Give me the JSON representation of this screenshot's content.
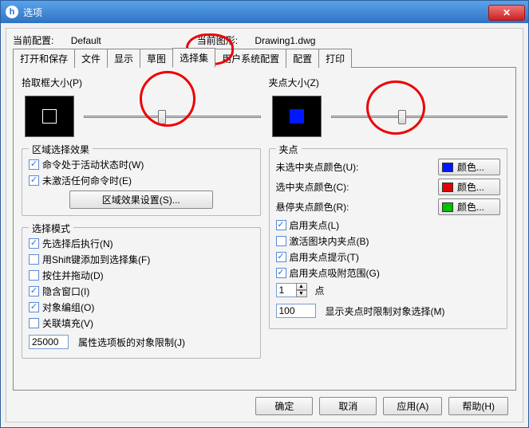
{
  "window": {
    "title": "选项",
    "app_glyph": "h"
  },
  "info": {
    "config_label": "当前配置:",
    "config_value": "Default",
    "drawing_label": "当前图形:",
    "drawing_value": "Drawing1.dwg"
  },
  "tabs": [
    "打开和保存",
    "文件",
    "显示",
    "草图",
    "选择集",
    "用户系统配置",
    "配置",
    "打印"
  ],
  "active_tab": "选择集",
  "left": {
    "pickbox_label": "拾取框大小(P)",
    "area_effect": {
      "title": "区域选择效果",
      "active_cmd": "命令处于活动状态时(W)",
      "inactive_cmd": "未激活任何命令时(E)",
      "settings_btn": "区域效果设置(S)..."
    },
    "select_mode": {
      "title": "选择模式",
      "pre_select": "先选择后执行(N)",
      "shift_add": "用Shift键添加到选择集(F)",
      "press_drag": "按住并拖动(D)",
      "implied_window": "隐含窗口(I)",
      "obj_group": "对象编组(O)",
      "assoc_fill": "关联填充(V)",
      "limit_value": "25000",
      "limit_label": "属性选项板的对象限制(J)"
    }
  },
  "right": {
    "gripsize_label": "夹点大小(Z)",
    "grips": {
      "title": "夹点",
      "unsel_color_label": "未选中夹点颜色(U):",
      "sel_color_label": "选中夹点颜色(C):",
      "hover_color_label": "悬停夹点颜色(R):",
      "color_btn": "颜色...",
      "colors": {
        "unsel": "#0018ff",
        "sel": "#e00000",
        "hover": "#00c000"
      },
      "enable_grips": "启用夹点(L)",
      "enable_block_grips": "激活图块内夹点(B)",
      "enable_grip_tips": "启用夹点提示(T)",
      "enable_grip_snap": "启用夹点吸附范围(G)",
      "pt_value": "1",
      "pt_label": "点",
      "limit_value": "100",
      "limit_label": "显示夹点时限制对象选择(M)"
    }
  },
  "footer": {
    "ok": "确定",
    "cancel": "取消",
    "apply": "应用(A)",
    "help": "帮助(H)"
  }
}
